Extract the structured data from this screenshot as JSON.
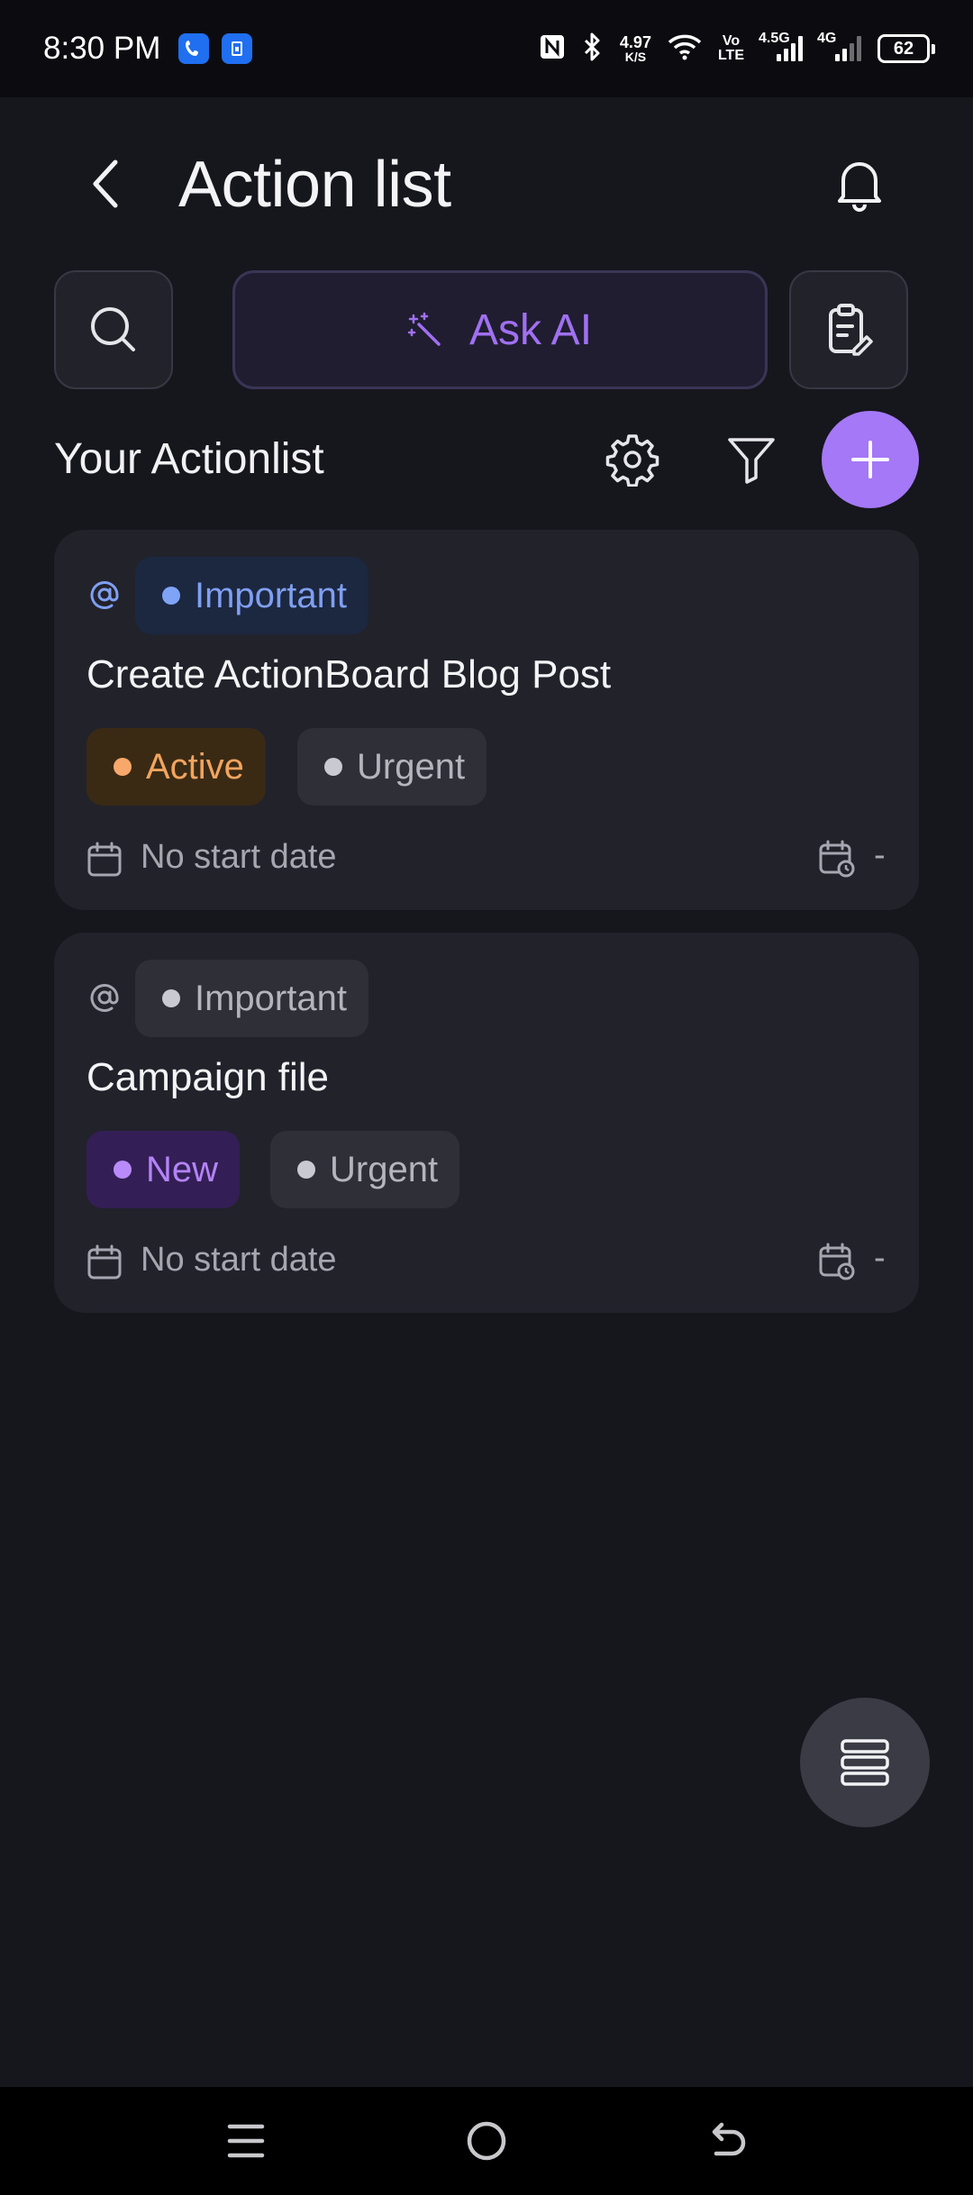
{
  "status_bar": {
    "time": "8:30 PM",
    "net_speed_value": "4.97",
    "net_speed_unit": "K/S",
    "volte_top": "Vo",
    "volte_bottom": "LTE",
    "signal1_label": "4.5G",
    "signal2_label": "4G",
    "battery": "62"
  },
  "header": {
    "title": "Action list",
    "back_icon": "chevron-left-icon",
    "bell_icon": "bell-icon"
  },
  "toolbar": {
    "search_icon": "search-icon",
    "ask_ai_label": "Ask AI",
    "ask_ai_icon": "magic-wand-icon",
    "clipboard_icon": "clipboard-edit-icon"
  },
  "section": {
    "title": "Your Actionlist"
  },
  "cards": [
    {
      "tag": "Important",
      "title": "Create ActionBoard Blog Post",
      "status": "Active",
      "priority": "Urgent",
      "start_date": "No start date",
      "due_date": "-"
    },
    {
      "tag": "Important",
      "title": "Campaign file",
      "status": "New",
      "priority": "Urgent",
      "start_date": "No start date",
      "due_date": "-"
    }
  ],
  "colors": {
    "background": "#16161d",
    "card": "#22222b",
    "accent": "#a578f7",
    "active": "#f2a45f",
    "new": "#b483f8",
    "important_blue": "#7f9ff2"
  }
}
